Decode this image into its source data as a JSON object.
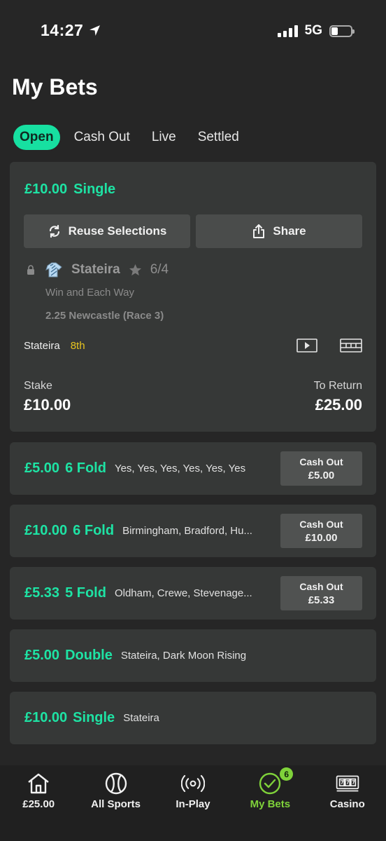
{
  "status": {
    "time": "14:27",
    "network": "5G"
  },
  "page": {
    "title": "My Bets"
  },
  "tabs": [
    {
      "label": "Open",
      "active": true
    },
    {
      "label": "Cash Out",
      "active": false
    },
    {
      "label": "Live",
      "active": false
    },
    {
      "label": "Settled",
      "active": false
    }
  ],
  "main_bet": {
    "amount": "£10.00",
    "type": "Single",
    "reuse_label": "Reuse Selections",
    "share_label": "Share",
    "selection": "Stateira",
    "odds": "6/4",
    "market": "Win and Each Way",
    "race": "2.25 Newcastle (Race 3)",
    "result_name": "Stateira",
    "result_position": "8th",
    "stake_label": "Stake",
    "stake_value": "£10.00",
    "return_label": "To Return",
    "return_value": "£25.00"
  },
  "bets": [
    {
      "amount": "£5.00",
      "type": "6 Fold",
      "desc": "Yes, Yes, Yes, Yes, Yes, Yes",
      "cashout_label": "Cash Out",
      "cashout_value": "£5.00"
    },
    {
      "amount": "£10.00",
      "type": "6 Fold",
      "desc": "Birmingham, Bradford, Hu...",
      "cashout_label": "Cash Out",
      "cashout_value": "£10.00"
    },
    {
      "amount": "£5.33",
      "type": "5 Fold",
      "desc": "Oldham, Crewe, Stevenage...",
      "cashout_label": "Cash Out",
      "cashout_value": "£5.33"
    },
    {
      "amount": "£5.00",
      "type": "Double",
      "desc": "Stateira, Dark Moon Rising"
    },
    {
      "amount": "£10.00",
      "type": "Single",
      "desc": "Stateira"
    }
  ],
  "nav": [
    {
      "label": "£25.00",
      "icon": "home-icon"
    },
    {
      "label": "All Sports",
      "icon": "tennis-ball-icon"
    },
    {
      "label": "In-Play",
      "icon": "broadcast-icon"
    },
    {
      "label": "My Bets",
      "icon": "check-circle-icon",
      "badge": "6",
      "active": true
    },
    {
      "label": "Casino",
      "icon": "slot-machine-icon"
    }
  ],
  "colors": {
    "accent": "#1ee3a4",
    "nav_active": "#7fd23a",
    "position": "#e8c51f",
    "background": "#262626",
    "card": "#363837"
  }
}
